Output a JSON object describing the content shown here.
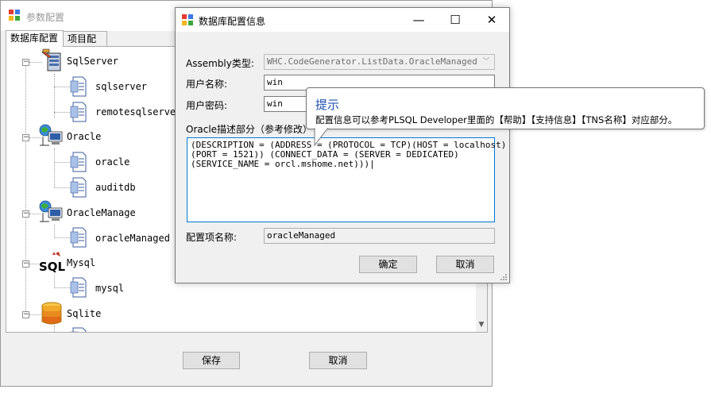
{
  "main_window": {
    "title": "参数配置",
    "tabs": [
      "数据库配置",
      "项目配置"
    ],
    "tree": [
      {
        "label": "SqlServer",
        "icon": "database-server-icon",
        "children": [
          "sqlserver",
          "remotesqlserver"
        ]
      },
      {
        "label": "Oracle",
        "icon": "network-computer-icon",
        "children": [
          "oracle",
          "auditdb"
        ]
      },
      {
        "label": "OracleManage",
        "icon": "network-computer-icon",
        "children": [
          "oracleManaged"
        ]
      },
      {
        "label": "Mysql",
        "icon": "sql-icon",
        "children": [
          "mysql"
        ]
      },
      {
        "label": "Sqlite",
        "icon": "database-stack-icon",
        "children": [
          ""
        ]
      }
    ],
    "save_label": "保存",
    "cancel_label": "取消"
  },
  "dialog": {
    "title": "数据库配置信息",
    "assembly_label": "Assembly类型:",
    "assembly_value": "WHC.CodeGenerator.ListData.OracleManaged",
    "username_label": "用户名称:",
    "username_value": "win",
    "password_label": "用户密码:",
    "password_value": "win",
    "oracle_desc_label": "Oracle描述部分（参考修改）",
    "oracle_desc_value": "(DESCRIPTION = (ADDRESS = (PROTOCOL = TCP)(HOST = localhost)\n(PORT = 1521)) (CONNECT_DATA = (SERVER = DEDICATED)\n(SERVICE_NAME = orcl.mshome.net)))|",
    "config_name_label": "配置项名称:",
    "config_name_value": "oracleManaged",
    "ok_label": "确定",
    "cancel_label": "取消"
  },
  "tooltip": {
    "title": "提示",
    "text": "配置信息可以参考PLSQL Developer里面的【帮助】【支持信息】【TNS名称】对应部分。"
  },
  "colors": {
    "accent": "#0078d7",
    "tooltip_title": "#1e4fb0"
  }
}
